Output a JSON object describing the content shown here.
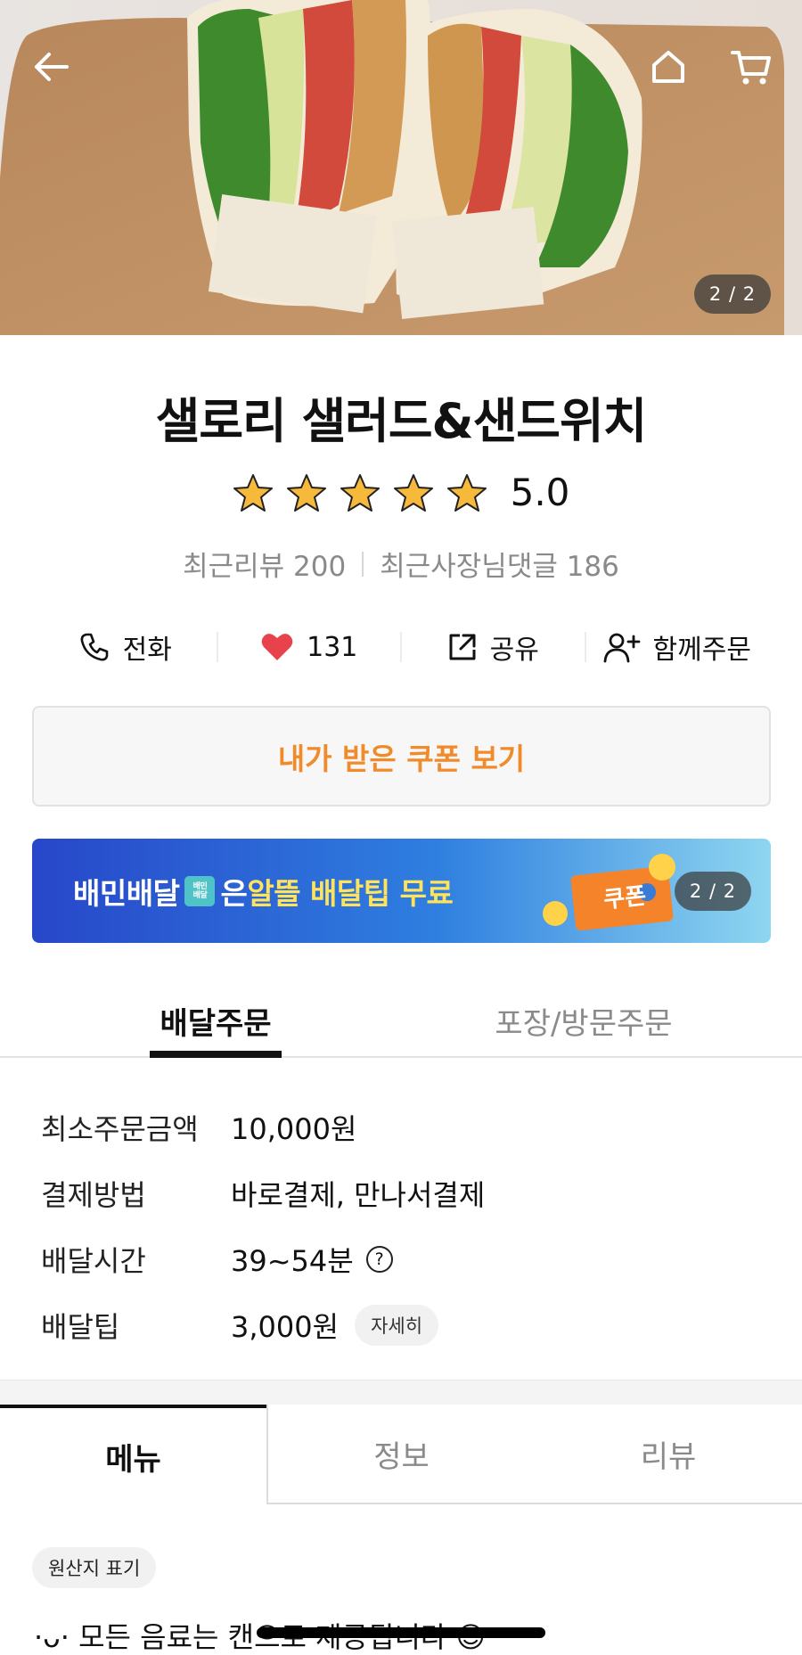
{
  "hero": {
    "image_counter": "2 / 2",
    "icons": {
      "back": "arrow-left-icon",
      "home": "home-icon",
      "cart": "cart-icon"
    }
  },
  "store": {
    "name": "샐로리 샐러드&샌드위치",
    "rating": {
      "stars": 5,
      "score": "5.0"
    },
    "recent_reviews": "최근리뷰 200",
    "recent_owner_replies": "최근사장님댓글 186"
  },
  "actions": [
    {
      "icon": "phone-icon",
      "label": "전화"
    },
    {
      "icon": "heart-icon",
      "label": "131"
    },
    {
      "icon": "share-icon",
      "label": "공유"
    },
    {
      "icon": "add-person-icon",
      "label": "함께주문"
    }
  ],
  "coupon_button": "내가 받은 쿠폰 보기",
  "banner": {
    "text_start": "배민배달",
    "badge": "배민\n배달",
    "text_end_plain": "은 ",
    "text_highlight": "알뜰 배달팁 무료",
    "coupon_tag": "쿠폰",
    "counter": "2 / 2"
  },
  "order_tabs": {
    "delivery": "배달주문",
    "pickup": "포장/방문주문"
  },
  "info": {
    "min_order": {
      "label": "최소주문금액",
      "value": "10,000원"
    },
    "payment": {
      "label": "결제방법",
      "value": "바로결제, 만나서결제"
    },
    "delivery_time": {
      "label": "배달시간",
      "value": "39~54분",
      "help": "?"
    },
    "delivery_tip": {
      "label": "배달팁",
      "value": "3,000원",
      "detail": "자세히"
    }
  },
  "menu_tabs": {
    "menu": "메뉴",
    "info": "정보",
    "review": "리뷰"
  },
  "origin_label": "원산지 표기",
  "notice": "·ᴗ· 모든 음료는 캔으로 제공됩니다 ☺",
  "colors": {
    "accent_orange": "#f08a2a",
    "heart": "#e8434c",
    "star": "#f6b93b",
    "banner_blue": "#2c4fcf"
  }
}
